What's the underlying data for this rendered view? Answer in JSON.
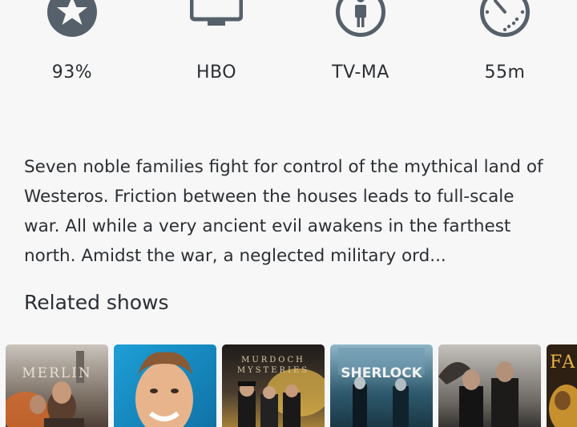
{
  "stats": [
    {
      "icon": "star-icon",
      "value": "93%"
    },
    {
      "icon": "tv-icon",
      "value": "HBO"
    },
    {
      "icon": "rating-person-icon",
      "value": "TV-MA"
    },
    {
      "icon": "runtime-clock-icon",
      "value": "55m"
    }
  ],
  "description": "Seven noble families fight for control of the mythical land of Westeros. Friction between the houses leads to full-scale war. All while a very ancient evil awakens in the farthest north. Amidst the war, a neglected military ord...",
  "related": {
    "title": "Related shows",
    "shows": [
      {
        "title": "MERLIN"
      },
      {
        "title": ""
      },
      {
        "title_line1": "MURDOCH",
        "title_line2": "MYSTERIES"
      },
      {
        "title": "SHERLOCK"
      },
      {
        "title": ""
      },
      {
        "title": "FA"
      }
    ]
  },
  "colors": {
    "icon": "#56606a",
    "text": "#2b2f33",
    "background": "#f7f7f7"
  }
}
